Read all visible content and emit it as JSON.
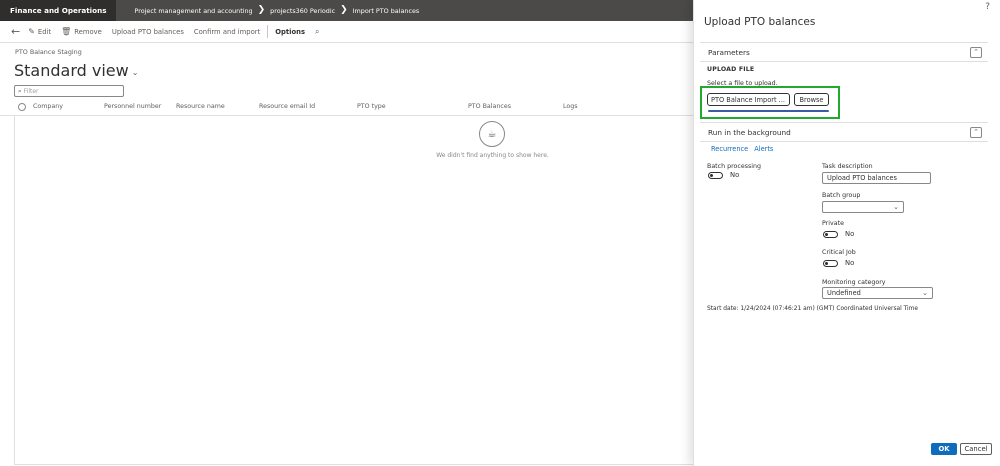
{
  "topbar": {
    "app_title": "Finance and Operations",
    "breadcrumbs": [
      "Project management and accounting",
      "projects360 Periodic",
      "Import PTO balances"
    ],
    "sep_glyph": "❯"
  },
  "actionbar": {
    "back_icon": "back-arrow-icon",
    "edit_label": "Edit",
    "remove_label": "Remove",
    "upload_label": "Upload PTO balances",
    "confirm_label": "Confirm and import",
    "options_label": "Options"
  },
  "page": {
    "subtitle": "PTO Balance Staging",
    "view_title": "Standard view",
    "filter_placeholder": "Filter",
    "columns": [
      "Company",
      "Personnel number",
      "Resource name",
      "Resource email Id",
      "PTO type",
      "PTO Balances",
      "Logs"
    ],
    "empty_message": "We didn't find anything to show here."
  },
  "dialog": {
    "help_glyph": "?",
    "title": "Upload PTO balances",
    "parameters": {
      "header": "Parameters",
      "upload_file_label": "UPLOAD FILE",
      "select_file_hint": "Select a file to upload.",
      "file_button_label": "PTO Balance Import ...",
      "browse_label": "Browse",
      "progress": 1.0
    },
    "background": {
      "header": "Run in the background",
      "tabs": [
        "Recurrence",
        "Alerts"
      ],
      "batch_processing_label": "Batch processing",
      "batch_processing_value": "No",
      "task_description_label": "Task description",
      "task_description_value": "Upload PTO balances",
      "batch_group_label": "Batch group",
      "batch_group_value": "",
      "private_label": "Private",
      "private_value": "No",
      "critical_job_label": "Critical Job",
      "critical_job_value": "No",
      "monitoring_category_label": "Monitoring category",
      "monitoring_category_value": "Undefined",
      "start_date_text": "Start date: 1/24/2024 (07:46:21 am) (GMT) Coordinated Universal Time"
    },
    "ok_label": "OK",
    "cancel_label": "Cancel"
  },
  "colors": {
    "topbar_bg": "#4b4a49",
    "app_title_bg": "#2f2e2d",
    "accent": "#0f6cbd",
    "highlight_box": "#22a82e",
    "progress_bar": "#3b5ba5"
  }
}
